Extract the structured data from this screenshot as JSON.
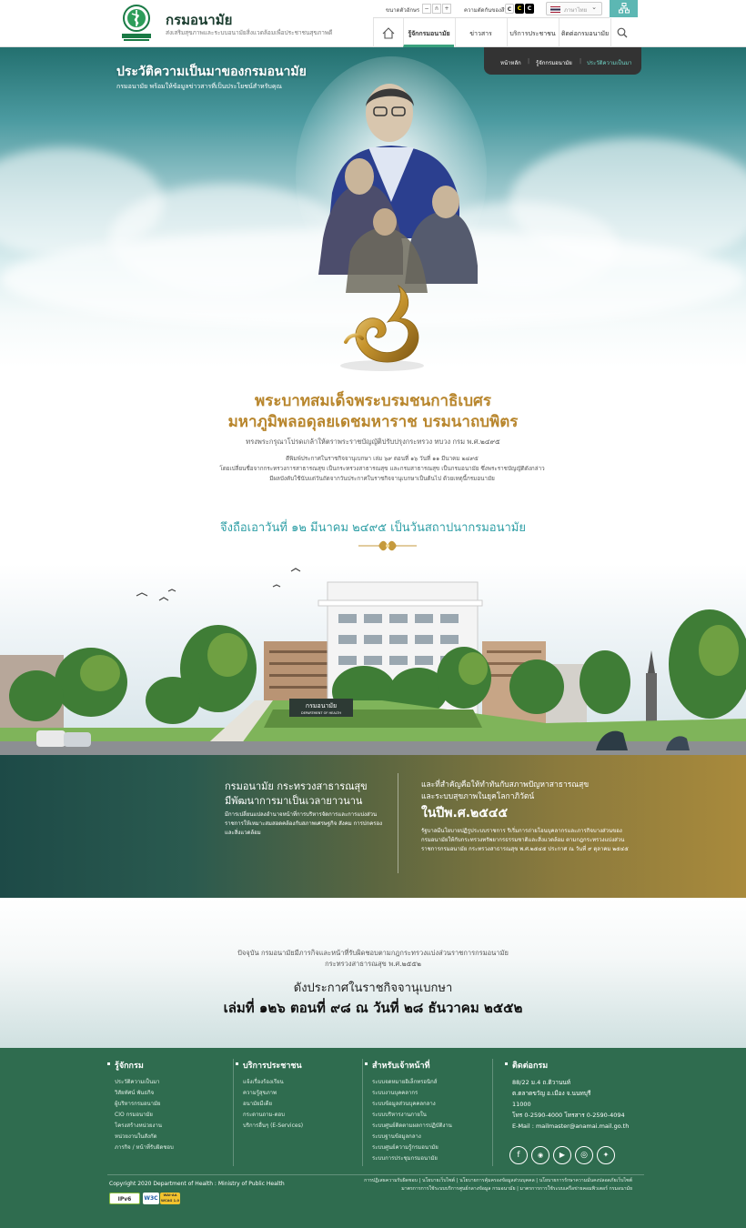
{
  "header": {
    "site_title": "กรมอนามัย",
    "site_subtitle": "ส่งเสริมสุขภาพและระบบอนามัยสิ่งแวดล้อมเพื่อประชาชนสุขภาพดี",
    "font_size_label": "ขนาดตัวอักษร",
    "font_minus": "−",
    "font_normal": "ก",
    "font_plus": "+",
    "contrast_label": "ความตัดกันของสี",
    "contrast_c1": "C",
    "contrast_c2": "C",
    "contrast_c3": "C",
    "language": "ภาษาไทย",
    "nav": [
      {
        "label": "รู้จักกรมอนามัย"
      },
      {
        "label": "ข่าวสาร"
      },
      {
        "label": "บริการประชาชน"
      },
      {
        "label": "ติดต่อกรมอนามัย"
      }
    ]
  },
  "hero": {
    "title": "ประวัติความเป็นมาของกรมอนามัย",
    "subtitle": "กรมอนามัย พร้อมให้ข้อมูลข่าวสารที่เป็นประโยชน์สำหรับคุณ",
    "breadcrumb": [
      "หน้าหลัก",
      "รู้จักกรมอนามัย",
      "ประวัติความเป็นมา"
    ],
    "king_name_1": "พระบาทสมเด็จพระบรมชนกาธิเบศร",
    "king_name_2": "มหาภูมิพลอดุลยเดชมหาราช บรมนาถบพิตร",
    "king_line": "ทรงพระกรุณาโปรดเกล้าให้ตราพระราชบัญญัติปรับปรุงกระทรวง ทบวง กรม พ.ศ.๒๔๙๕",
    "king_p1": "ตีพิมพ์ประกาศในราชกิจจานุเบกษา เล่ม ๖๙ ตอนที่ ๑๖ วันที่ ๑๑ มีนาคม ๒๔๙๕",
    "king_p2": "โดยเปลี่ยนชื่อจากกระทรวงการสาธารณสุข เป็นกระทรวงสาธารณสุข และกรมสาธารณสุข เป็นกรมอนามัย ซึ่งพระราชบัญญัติดังกล่าว",
    "king_p3": "มีผลบังคับใช้นับแต่วันถัดจากวันประกาศในราชกิจจานุเบกษาเป็นต้นไป ด้วยเหตุนี้กรมอนามัย",
    "founding": "จึงถือเอาวันที่ ๑๒ มีนาคม ๒๔๙๕ เป็นวันสถาปนากรมอนามัย"
  },
  "building": {
    "sign_text_1": "กรมอนามัย",
    "sign_text_2": "DEPARTMENT OF HEALTH"
  },
  "story": {
    "left_heading_1": "กรมอนามัย กระทรวงสาธารณสุข",
    "left_heading_2": "มีพัฒนาการมาเป็นเวลายาวนาน",
    "left_body": "มีการเปลี่ยนแปลงอำนาจหน้าที่การบริหารจัดการและการแบ่งส่วนราชการให้เหมาะสมสอดคล้องกับสภาพเศรษฐกิจ สังคม การปกครองและสิ่งแวดล้อม",
    "right_heading_1": "และที่สำคัญคือให้ทำทันกับสภาพปัญหาสาธารณสุข",
    "right_heading_2": "และระบบสุขภาพในยุคโลกาภิวัตน์",
    "right_year": "ในปีพ.ศ.๒๕๔๕",
    "right_body": "รัฐบาลมีนโยบายปฏิรูประบบราชการ ริเริ่มการถ่ายโอนบุคลากรและภารกิจบางส่วนของกรมอนามัยให้กับกระทรวงทรัพยากรธรรมชาติและสิ่งแวดล้อม ตามกฎกระทรวงแบ่งส่วนราชการกรมอนามัย กระทรวงสาธารณสุข พ.ศ.๒๕๔๕ ประกาศ ณ วันที่ ๙ ตุลาคม ๒๕๔๕"
  },
  "current": {
    "p1": "ปัจจุบัน กรมอนามัยมีภารกิจและหน้าที่รับผิดชอบตามกฎกระทรวงแบ่งส่วนราชการกรมอนามัย",
    "p2": "กระทรวงสาธารณสุข พ.ศ.๒๕๕๒",
    "h1": "ดังประกาศในราชกิจจานุเบกษา",
    "h2": "เล่มที่ ๑๒๖ ตอนที่ ๙๘ ณ วันที่ ๒๘ ธันวาคม ๒๕๕๒"
  },
  "footer": {
    "col1": {
      "title": "รู้จักกรม",
      "links": [
        "ประวัติความเป็นมา",
        "วิสัยทัศน์ พันธกิจ",
        "ผู้บริหารกรมอนามัย",
        "CIO กรมอนามัย",
        "โครงสร้างหน่วยงาน",
        "หน่วยงานในสังกัด",
        "ภารกิจ / หน้าที่รับผิดชอบ"
      ]
    },
    "col2": {
      "title": "บริการประชาชน",
      "links": [
        "แจ้งเรื่องร้องเรียน",
        "ความรู้สุขภาพ",
        "อนามัยมีเดีย",
        "กระดานถาม-ตอบ",
        "บริการอื่นๆ (E-Services)"
      ]
    },
    "col3": {
      "title": "สำหรับเจ้าหน้าที่",
      "links": [
        "ระบบจดหมายอิเล็กทรอนิกส์",
        "ระบบงานบุคคลากร",
        "ระบบข้อมูลส่วนบุคคลกลาง",
        "ระบบบริหารงานภายใน",
        "ระบบศูนย์ติดตามผลการปฏิบัติงาน",
        "ระบบฐานข้อมูลกลาง",
        "ระบบศูนย์ความรู้กรมอนามัย",
        "ระบบการประชุมกรมอนามัย"
      ]
    },
    "col4": {
      "title": "ติดต่อกรม",
      "lines": [
        "88/22 ม.4 ถ.ติวานนท์",
        "ต.ตลาดขวัญ อ.เมือง จ.นนทบุรี",
        "11000",
        "โทร 0-2590-4000 โทรสาร 0-2590-4094",
        "E-Mail : mailmaster@anamai.mail.go.th"
      ]
    },
    "social": [
      "facebook-icon",
      "line-icon",
      "youtube-icon",
      "instagram-icon",
      "twitter-icon"
    ],
    "copyright": "Copyright 2020 Department of Health : Ministry of Public Health",
    "badge_ipv6": "IPv6",
    "badge_w3c": "W3C",
    "badge_wai": "WAI-AA WCAG 1.0",
    "policies_1": "การปฏิเสธความรับผิดชอบ | นโยบายเว็บไซต์ | นโยบายการคุ้มครองข้อมูลส่วนบุคคล | นโยบายการรักษาความมั่นคงปลอดภัยเว็บไซต์",
    "policies_2": "มาตรการการใช้ระบบบริการศูนย์กลางข้อมูล กรมอนามัย | มาตรการการใช้ระบบเครือข่ายคอมพิวเตอร์ กรมอนามัย"
  }
}
